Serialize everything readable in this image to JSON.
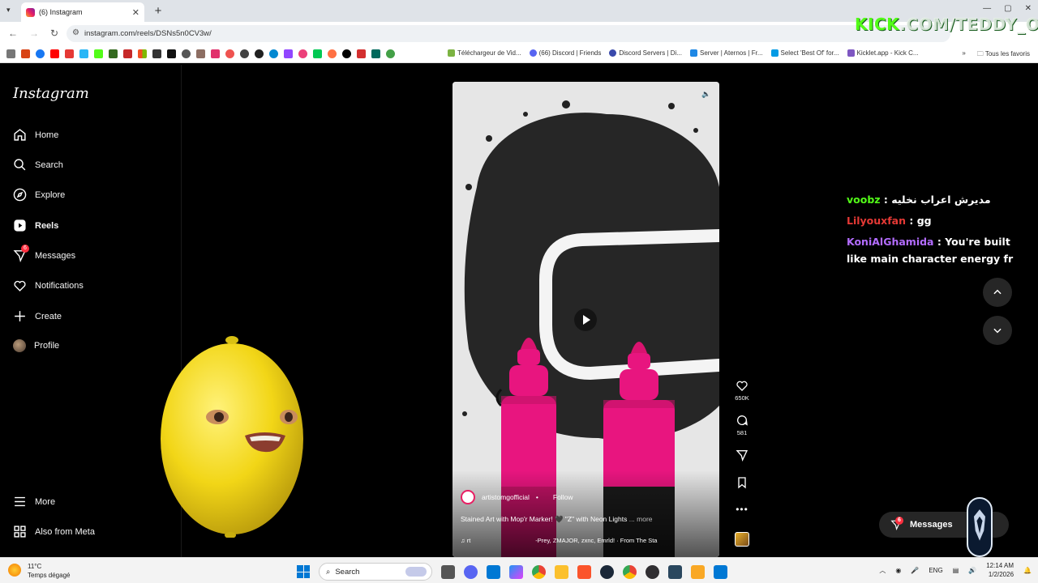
{
  "browser": {
    "tab_title": "(6) Instagram",
    "tab_close": "✕",
    "new_tab": "+",
    "url": "instagram.com/reels/DSNs5n0CV3w/",
    "bookmarks": [
      "Téléchargeur de Vid...",
      "(66) Discord | Friends",
      "Discord Servers | Di...",
      "Server | Aternos | Fr...",
      "Select 'Best Of' for...",
      "Kicklet.app - Kick C..."
    ],
    "bookmarks_overflow": "»",
    "all_bookmarks": "Tous les favoris",
    "window_controls": [
      "—",
      "▢",
      "✕"
    ]
  },
  "overlay": {
    "kick_green": "KICK",
    "kick_rest": ".COM/TEDDY_OMG"
  },
  "sidebar": {
    "logo": "Instagram",
    "items": [
      {
        "label": "Home",
        "icon": "home-icon"
      },
      {
        "label": "Search",
        "icon": "search-icon"
      },
      {
        "label": "Explore",
        "icon": "compass-icon"
      },
      {
        "label": "Reels",
        "icon": "reels-icon"
      },
      {
        "label": "Messages",
        "icon": "messenger-icon",
        "badge": "6"
      },
      {
        "label": "Notifications",
        "icon": "heart-icon"
      },
      {
        "label": "Create",
        "icon": "plus-icon"
      },
      {
        "label": "Profile",
        "icon": "avatar"
      }
    ],
    "more": "More",
    "also_from_meta": "Also from Meta"
  },
  "reel": {
    "username": "artistomgofficial",
    "follow": "Follow",
    "dot": "•",
    "caption": "Stained Art with Mop'r Marker! 🖤 \"Z\" with Neon Lights",
    "caption_more": "... more",
    "audio_left": "♫ rt",
    "audio_right": "-Prey, ZMAJOR, zxnc, Emrld! · From The Sta"
  },
  "actions": {
    "likes": "650K",
    "comments": "581"
  },
  "chat": [
    {
      "user": "voobz",
      "text": "مديرش اعراب نخليه"
    },
    {
      "user": "Lilyouxfan",
      "text": "gg"
    },
    {
      "user": "KoniAlGhamida",
      "text": "You're built like main character energy fr"
    }
  ],
  "chat_separator": " : ",
  "messages_pill": {
    "label": "Messages",
    "badge": "6"
  },
  "taskbar": {
    "temp": "11°C",
    "weather": "Temps dégagé",
    "search": "Search",
    "lang": "ENG",
    "time": "12:14 AM",
    "date": "1/2/2026"
  },
  "colors": {
    "kick_green": "#53fc18",
    "insta_badge": "#ff3040",
    "chat_red": "#e53935",
    "chat_purple": "#b36cff",
    "marker_pink": "#e8157f"
  }
}
